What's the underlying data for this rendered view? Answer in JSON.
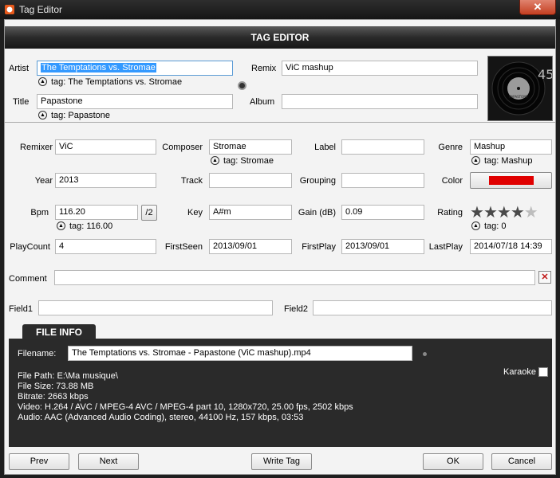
{
  "window": {
    "title": "Tag Editor",
    "close_glyph": "✕"
  },
  "header": {
    "title": "TAG EDITOR"
  },
  "fields": {
    "artist": {
      "label": "Artist",
      "value": "The Temptations vs. Stromae",
      "tag": "tag: The Temptations vs. Stromae"
    },
    "remix": {
      "label": "Remix",
      "value": "ViC mashup"
    },
    "title": {
      "label": "Title",
      "value": "Papastone",
      "tag": "tag: Papastone"
    },
    "album": {
      "label": "Album",
      "value": ""
    },
    "remixer": {
      "label": "Remixer",
      "value": "ViC"
    },
    "composer": {
      "label": "Composer",
      "value": "Stromae",
      "tag": "tag: Stromae"
    },
    "label": {
      "label": "Label",
      "value": ""
    },
    "genre": {
      "label": "Genre",
      "value": "Mashup",
      "tag": "tag: Mashup"
    },
    "year": {
      "label": "Year",
      "value": "2013"
    },
    "track": {
      "label": "Track",
      "value": ""
    },
    "grouping": {
      "label": "Grouping",
      "value": ""
    },
    "color": {
      "label": "Color",
      "value": "#e00000"
    },
    "bpm": {
      "label": "Bpm",
      "value": "116.20",
      "tag": "tag: 116.00",
      "half_button": "/2"
    },
    "key": {
      "label": "Key",
      "value": "A#m"
    },
    "gain": {
      "label": "Gain (dB)",
      "value": "0.09"
    },
    "rating": {
      "label": "Rating",
      "stars": 4,
      "max": 5,
      "tag": "tag: 0"
    },
    "playcount": {
      "label": "PlayCount",
      "value": "4"
    },
    "firstseen": {
      "label": "FirstSeen",
      "value": "2013/09/01"
    },
    "firstplay": {
      "label": "FirstPlay",
      "value": "2013/09/01"
    },
    "lastplay": {
      "label": "LastPlay",
      "value": "2014/07/18 14:39"
    },
    "comment": {
      "label": "Comment",
      "value": ""
    },
    "field1": {
      "label": "Field1",
      "value": ""
    },
    "field2": {
      "label": "Field2",
      "value": ""
    }
  },
  "file_info": {
    "tab_label": "FILE INFO",
    "filename_label": "Filename:",
    "filename": "The Temptations vs. Stromae - Papastone (ViC mashup).mp4",
    "path": "File Path: E:\\Ma musique\\",
    "size": "File Size: 73.88 MB",
    "bitrate": "Bitrate: 2663 kbps",
    "video": "Video: H.264 / AVC / MPEG-4 AVC / MPEG-4 part 10, 1280x720, 25.00 fps, 2502 kbps",
    "audio": "Audio: AAC (Advanced Audio Coding), stereo, 44100 Hz, 157 kbps, 03:53",
    "karaoke_label": "Karaoke",
    "karaoke_checked": false
  },
  "buttons": {
    "prev": "Prev",
    "next": "Next",
    "write_tag": "Write Tag",
    "ok": "OK",
    "cancel": "Cancel"
  },
  "cover_art": {
    "label_text": "PAPASTONE"
  },
  "colors": {
    "header_bg": "#1e1e1e",
    "selection": "#3399ff",
    "track_color": "#e00000",
    "close_red": "#c43f21"
  }
}
